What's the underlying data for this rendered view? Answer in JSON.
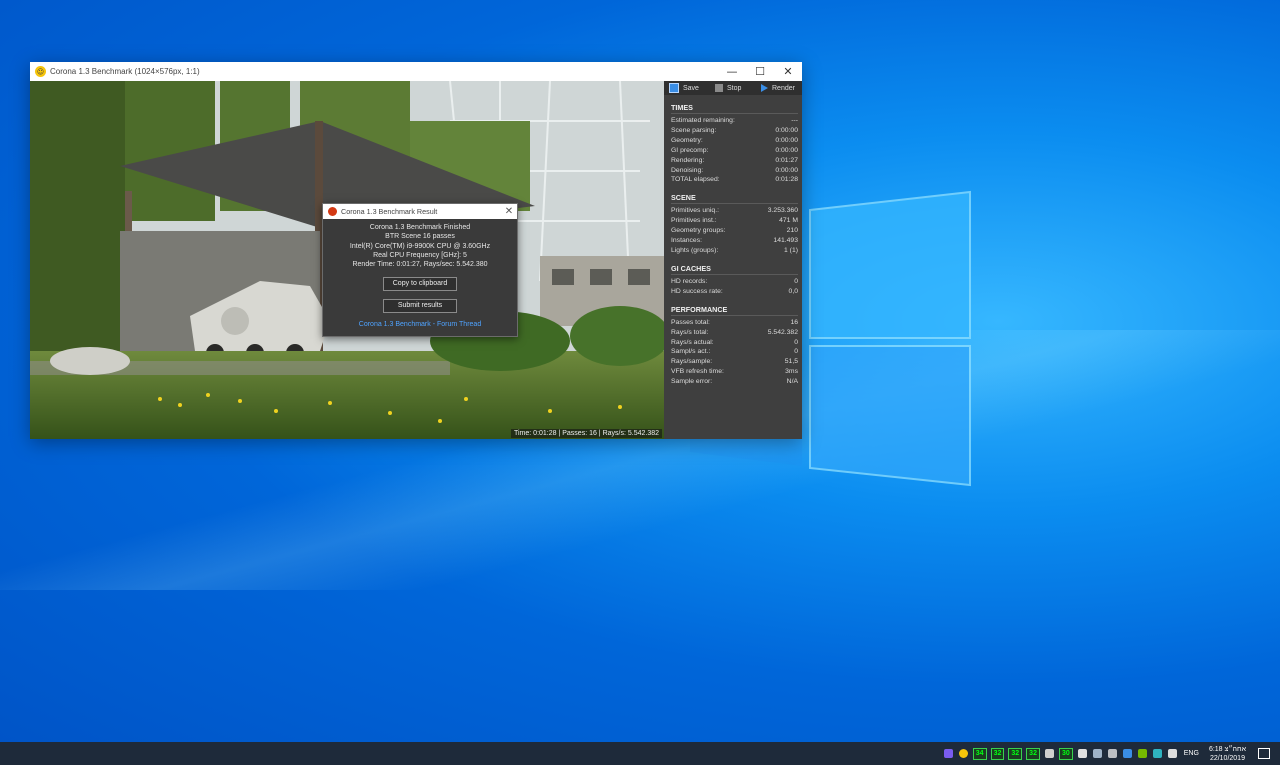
{
  "window": {
    "title": "Corona 1.3 Benchmark (1024×576px, 1:1)",
    "min_glyph": "—",
    "max_glyph": "☐",
    "close_glyph": "✕",
    "viewport_status": "Time: 0:01:28 | Passes: 16 | Rays/s: 5.542.382"
  },
  "toolbar": {
    "save": "Save",
    "stop": "Stop",
    "render": "Render"
  },
  "dialog": {
    "title": "Corona 1.3 Benchmark Result",
    "close_glyph": "✕",
    "lines": [
      "Corona 1.3 Benchmark Finished",
      "BTR Scene 16 passes",
      "Intel(R) Core(TM) i9-9900K CPU @ 3.60GHz",
      "Real CPU Frequency [GHz]: 5",
      "Render Time: 0:01:27, Rays/sec: 5.542.380"
    ],
    "copy_button": "Copy to clipboard",
    "submit_button": "Submit results",
    "forum_link": "Corona 1.3 Benchmark - Forum Thread"
  },
  "panel": {
    "times": {
      "title": "TIMES",
      "rows": [
        {
          "label": "Estimated remaining:",
          "value": "---"
        },
        {
          "label": "Scene parsing:",
          "value": "0:00:00"
        },
        {
          "label": "Geometry:",
          "value": "0:00:00"
        },
        {
          "label": "GI precomp:",
          "value": "0:00:00"
        },
        {
          "label": "Rendering:",
          "value": "0:01:27"
        },
        {
          "label": "Denoising:",
          "value": "0:00:00"
        },
        {
          "label": "TOTAL elapsed:",
          "value": "0:01:28"
        }
      ]
    },
    "scene": {
      "title": "SCENE",
      "rows": [
        {
          "label": "Primitives uniq.:",
          "value": "3.253.360"
        },
        {
          "label": "Primitives inst.:",
          "value": "471 M"
        },
        {
          "label": "Geometry groups:",
          "value": "210"
        },
        {
          "label": "Instances:",
          "value": "141.493"
        },
        {
          "label": "Lights (groups):",
          "value": "1 (1)"
        }
      ]
    },
    "gi": {
      "title": "GI CACHES",
      "rows": [
        {
          "label": "HD records:",
          "value": "0"
        },
        {
          "label": "HD success rate:",
          "value": "0,0"
        }
      ]
    },
    "performance": {
      "title": "PERFORMANCE",
      "rows": [
        {
          "label": "Passes total:",
          "value": "16"
        },
        {
          "label": "Rays/s total:",
          "value": "5.542.382"
        },
        {
          "label": "Rays/s actual:",
          "value": "0"
        },
        {
          "label": "Sampl/s act.:",
          "value": "0"
        },
        {
          "label": "Rays/sample:",
          "value": "51,5"
        },
        {
          "label": "VFB refresh time:",
          "value": "3ms"
        },
        {
          "label": "Sample error:",
          "value": "N/A"
        }
      ]
    }
  },
  "taskbar": {
    "tray_numbers": [
      "34",
      "32",
      "32",
      "32",
      "30"
    ],
    "language": "ENG",
    "time": "6:18 ‫אחה״צ‬",
    "date": "22/10/2019"
  }
}
